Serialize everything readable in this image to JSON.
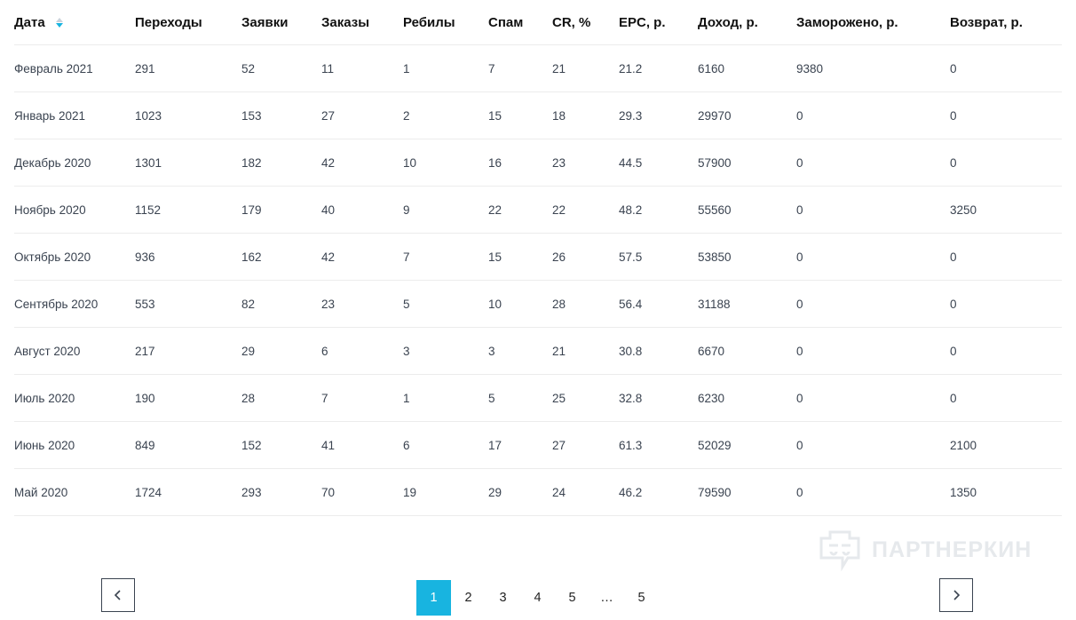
{
  "table": {
    "headers": [
      "Дата",
      "Переходы",
      "Заявки",
      "Заказы",
      "Ребилы",
      "Спам",
      "CR, %",
      "EPC, р.",
      "Доход, р.",
      "Заморожено, р.",
      "Возврат, р."
    ],
    "rows": [
      [
        "Февраль 2021",
        "291",
        "52",
        "11",
        "1",
        "7",
        "21",
        "21.2",
        "6160",
        "9380",
        "0"
      ],
      [
        "Январь 2021",
        "1023",
        "153",
        "27",
        "2",
        "15",
        "18",
        "29.3",
        "29970",
        "0",
        "0"
      ],
      [
        "Декабрь 2020",
        "1301",
        "182",
        "42",
        "10",
        "16",
        "23",
        "44.5",
        "57900",
        "0",
        "0"
      ],
      [
        "Ноябрь 2020",
        "1152",
        "179",
        "40",
        "9",
        "22",
        "22",
        "48.2",
        "55560",
        "0",
        "3250"
      ],
      [
        "Октябрь 2020",
        "936",
        "162",
        "42",
        "7",
        "15",
        "26",
        "57.5",
        "53850",
        "0",
        "0"
      ],
      [
        "Сентябрь 2020",
        "553",
        "82",
        "23",
        "5",
        "10",
        "28",
        "56.4",
        "31188",
        "0",
        "0"
      ],
      [
        "Август 2020",
        "217",
        "29",
        "6",
        "3",
        "3",
        "21",
        "30.8",
        "6670",
        "0",
        "0"
      ],
      [
        "Июль 2020",
        "190",
        "28",
        "7",
        "1",
        "5",
        "25",
        "32.8",
        "6230",
        "0",
        "0"
      ],
      [
        "Июнь 2020",
        "849",
        "152",
        "41",
        "6",
        "17",
        "27",
        "61.3",
        "52029",
        "0",
        "2100"
      ],
      [
        "Май 2020",
        "1724",
        "293",
        "70",
        "19",
        "29",
        "24",
        "46.2",
        "79590",
        "0",
        "1350"
      ]
    ]
  },
  "pagination": {
    "pages": [
      "1",
      "2",
      "3",
      "4",
      "5",
      "…",
      "5"
    ],
    "active_index": 0
  },
  "watermark": {
    "text": "ПАРТНЕРКИН"
  },
  "colors": {
    "accent": "#18b4e0",
    "text": "#3a4350",
    "heading": "#111111",
    "divider": "#ececec",
    "watermark": "#e6e9ec"
  },
  "icons": {
    "prev": "chevron-left-icon",
    "next": "chevron-right-icon",
    "sort": "sort-arrows-icon",
    "watermark": "partnerkin-logo-icon"
  }
}
